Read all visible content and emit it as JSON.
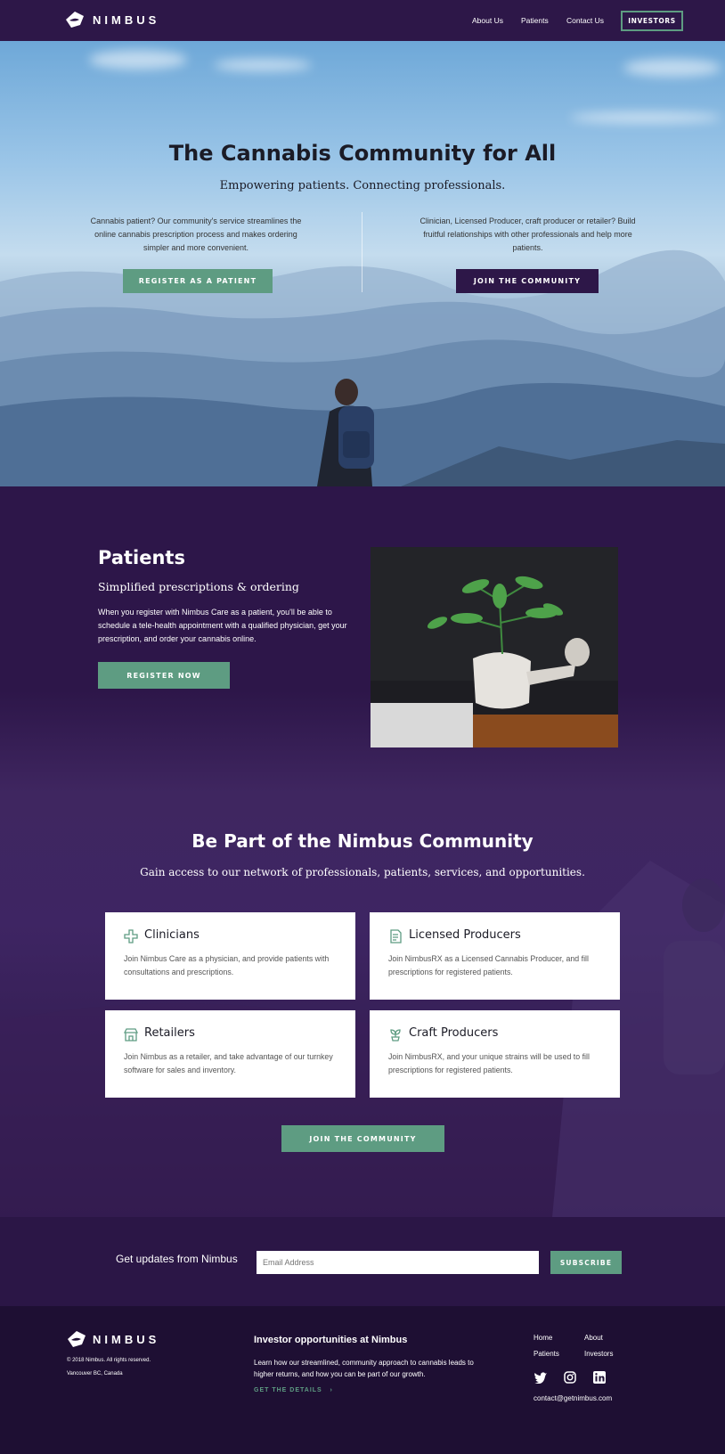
{
  "header": {
    "brand": "NIMBUS",
    "nav": [
      "About Us",
      "Patients",
      "Contact Us"
    ],
    "investors_label": "INVESTORS"
  },
  "hero": {
    "title": "The Cannabis Community for All",
    "subtitle": "Empowering patients. Connecting professionals.",
    "left_text": "Cannabis patient? Our community's service streamlines the online cannabis prescription process and makes ordering simpler and more convenient.",
    "left_button": "REGISTER AS A PATIENT",
    "right_text": "Clinician, Licensed Producer, craft producer or retailer? Build fruitful relationships with other professionals and help more patients.",
    "right_button": "JOIN THE COMMUNITY"
  },
  "patients": {
    "title": "Patients",
    "subtitle": "Simplified prescriptions & ordering",
    "body": "When you register with Nimbus Care as a patient, you'll be able to schedule a tele-health appointment with a qualified physician, get your prescription, and order your cannabis online.",
    "button": "REGISTER NOW"
  },
  "community": {
    "title": "Be Part of the Nimbus Community",
    "subtitle": "Gain access to our network of professionals, patients, services, and opportunities.",
    "cards": [
      {
        "title": "Clinicians",
        "icon": "cross-icon",
        "text": "Join Nimbus Care as a physician, and provide patients with consultations and prescriptions."
      },
      {
        "title": "Licensed Producers",
        "icon": "document-icon",
        "text": "Join NimbusRX as a Licensed Cannabis Producer, and fill prescriptions for registered patients."
      },
      {
        "title": "Retailers",
        "icon": "store-icon",
        "text": "Join Nimbus as a retailer, and take advantage of our turnkey software for sales and inventory."
      },
      {
        "title": "Craft Producers",
        "icon": "plant-icon",
        "text": "Join NimbusRX, and your unique strains will be used to fill prescriptions for registered patients."
      }
    ],
    "button": "JOIN THE COMMUNITY"
  },
  "newsletter": {
    "label": "Get updates from Nimbus",
    "placeholder": "Email Address",
    "button": "SUBSCRIBE"
  },
  "footer": {
    "brand": "NIMBUS",
    "copyright": "© 2018 Nimbus. All rights reserved.",
    "location": "Vancouver BC, Canada",
    "investor_title": "Investor opportunities at Nimbus",
    "investor_text": "Learn how our streamlined, community approach to cannabis leads to higher returns, and how you can be part of our growth.",
    "investor_link": "GET THE DETAILS",
    "links": [
      "Home",
      "About",
      "Patients",
      "Investors"
    ],
    "social": [
      "twitter-icon",
      "instagram-icon",
      "linkedin-icon"
    ],
    "email": "contact@getnimbus.com"
  },
  "colors": {
    "purple": "#2d1748",
    "green": "#5e9c82",
    "dark": "#1e0f33"
  }
}
